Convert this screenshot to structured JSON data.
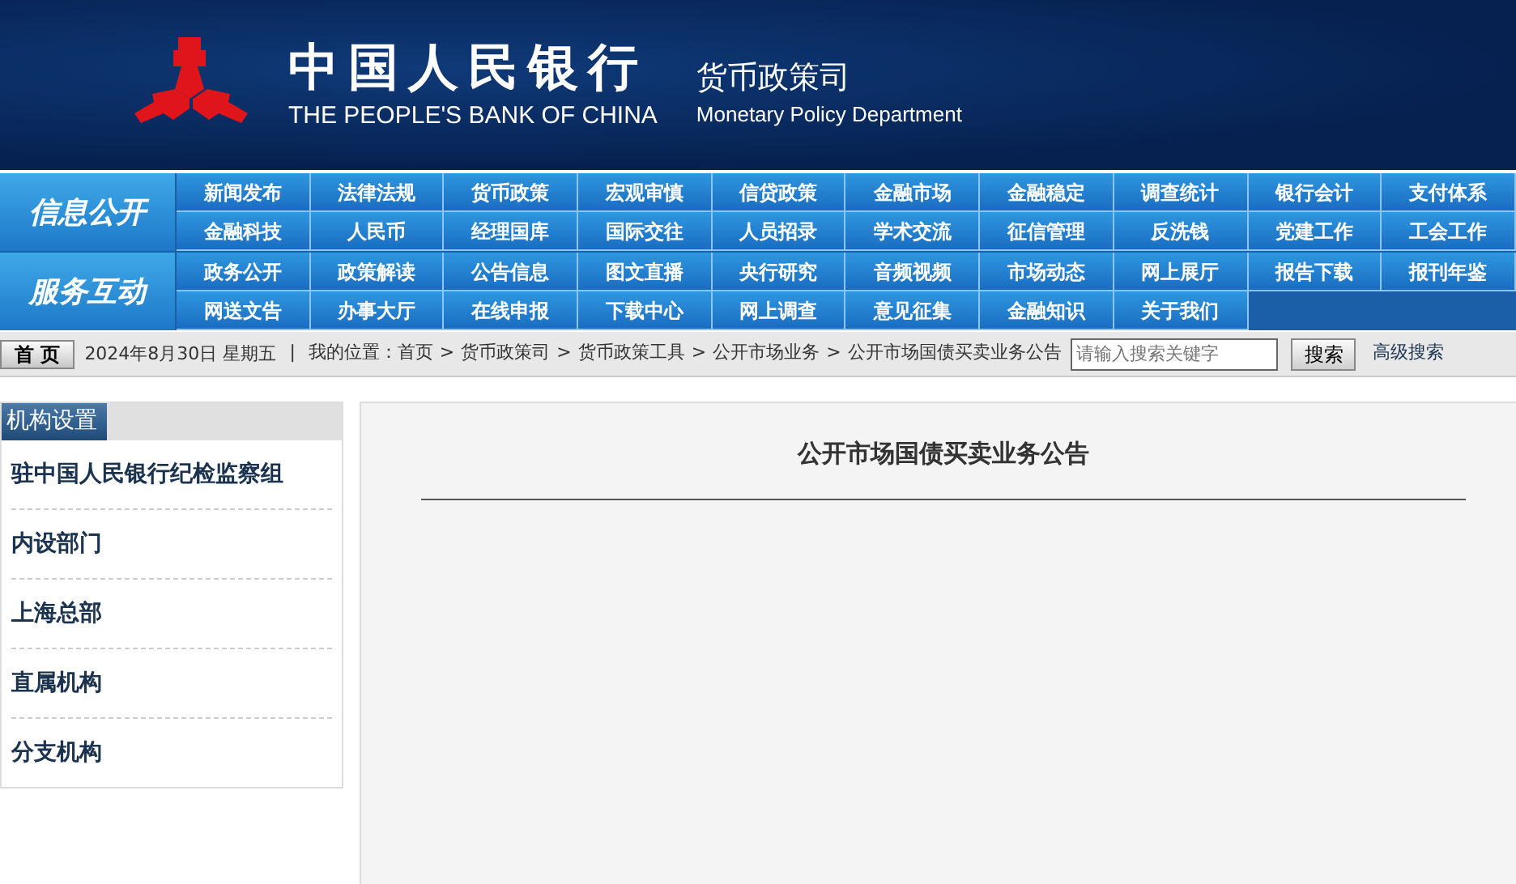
{
  "header": {
    "bank_name_cn": "中国人民银行",
    "bank_name_en": "THE PEOPLE'S BANK OF CHINA",
    "department_cn": "货币政策司",
    "department_en": "Monetary Policy Department"
  },
  "nav_groups": [
    {
      "label": "信息公开",
      "items": [
        "新闻发布",
        "法律法规",
        "货币政策",
        "宏观审慎",
        "信贷政策",
        "金融市场",
        "金融稳定",
        "调查统计",
        "银行会计",
        "支付体系",
        "金融科技",
        "人民币",
        "经理国库",
        "国际交往",
        "人员招录",
        "学术交流",
        "征信管理",
        "反洗钱",
        "党建工作",
        "工会工作"
      ]
    },
    {
      "label": "服务互动",
      "items": [
        "政务公开",
        "政策解读",
        "公告信息",
        "图文直播",
        "央行研究",
        "音频视频",
        "市场动态",
        "网上展厅",
        "报告下载",
        "报刊年鉴",
        "网送文告",
        "办事大厅",
        "在线申报",
        "下载中心",
        "网上调查",
        "意见征集",
        "金融知识",
        "关于我们"
      ]
    }
  ],
  "toolbar": {
    "home_button": "首 页",
    "date": "2024年8月30日 星期五",
    "separator": "|",
    "location_label": "我的位置：",
    "breadcrumb": [
      "首页",
      "货币政策司",
      "货币政策工具",
      "公开市场业务",
      "公开市场国债买卖业务公告"
    ],
    "breadcrumb_separator": ">",
    "search_placeholder": "请输入搜索关键字",
    "search_button": "搜索",
    "advanced_search": "高级搜索"
  },
  "sidebar": {
    "title": "机构设置",
    "items": [
      "驻中国人民银行纪检监察组",
      "内设部门",
      "上海总部",
      "直属机构",
      "分支机构"
    ]
  },
  "article": {
    "title": "公开市场国债买卖业务公告"
  }
}
